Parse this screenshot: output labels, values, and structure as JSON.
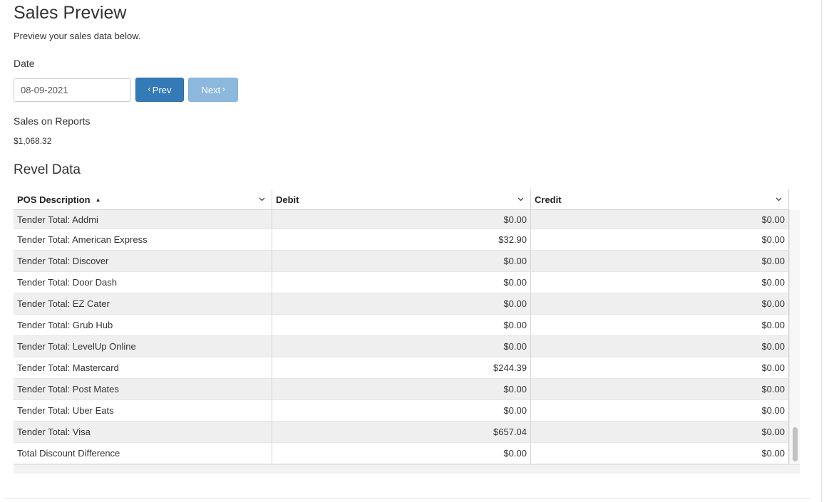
{
  "page": {
    "title": "Sales Preview",
    "subtitle": "Preview your sales data below."
  },
  "date_section": {
    "label": "Date",
    "value": "08-09-2021",
    "prev_label": "Prev",
    "next_label": "Next"
  },
  "sales_on_reports": {
    "label": "Sales on Reports",
    "value": "$1,068.32"
  },
  "revel": {
    "title": "Revel Data",
    "columns": [
      {
        "label": "POS Description",
        "sort": "ascending"
      },
      {
        "label": "Debit"
      },
      {
        "label": "Credit"
      }
    ],
    "rows": [
      {
        "description": "Tender Total: Addmi",
        "debit": "$0.00",
        "credit": "$0.00"
      },
      {
        "description": "Tender Total: American Express",
        "debit": "$32.90",
        "credit": "$0.00"
      },
      {
        "description": "Tender Total: Discover",
        "debit": "$0.00",
        "credit": "$0.00"
      },
      {
        "description": "Tender Total: Door Dash",
        "debit": "$0.00",
        "credit": "$0.00"
      },
      {
        "description": "Tender Total: EZ Cater",
        "debit": "$0.00",
        "credit": "$0.00"
      },
      {
        "description": "Tender Total: Grub Hub",
        "debit": "$0.00",
        "credit": "$0.00"
      },
      {
        "description": "Tender Total: LevelUp Online",
        "debit": "$0.00",
        "credit": "$0.00"
      },
      {
        "description": "Tender Total: Mastercard",
        "debit": "$244.39",
        "credit": "$0.00"
      },
      {
        "description": "Tender Total: Post Mates",
        "debit": "$0.00",
        "credit": "$0.00"
      },
      {
        "description": "Tender Total: Uber Eats",
        "debit": "$0.00",
        "credit": "$0.00"
      },
      {
        "description": "Tender Total: Visa",
        "debit": "$657.04",
        "credit": "$0.00"
      },
      {
        "description": "Total Discount Difference",
        "debit": "$0.00",
        "credit": "$0.00"
      }
    ]
  },
  "icons": {
    "prev": "chevron-left-icon",
    "next": "chevron-right-icon",
    "sort": "sort-ascending-icon",
    "column_menu": "chevron-down-icon"
  },
  "colors": {
    "primary": "#337ab7",
    "primary_disabled": "#8db8de",
    "row_stripe": "#efefef"
  }
}
